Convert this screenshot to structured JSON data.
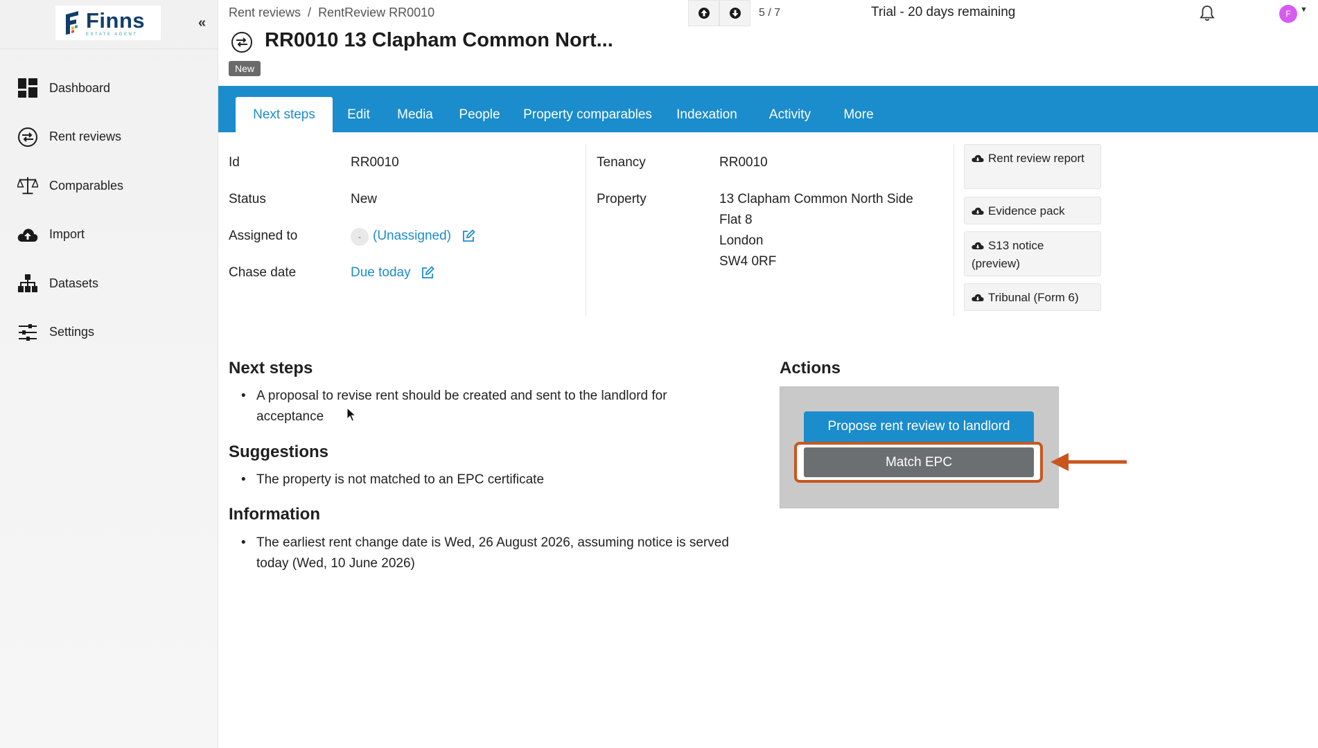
{
  "sidebar": {
    "logo_name": "Finns",
    "logo_sub": "ESTATE AGENT",
    "collapse_glyph": "«",
    "items": [
      {
        "label": "Dashboard",
        "icon": "dashboard-grid-icon"
      },
      {
        "label": "Rent reviews",
        "icon": "rent-review-icon"
      },
      {
        "label": "Comparables",
        "icon": "scales-icon"
      },
      {
        "label": "Import",
        "icon": "cloud-upload-icon"
      },
      {
        "label": "Datasets",
        "icon": "hierarchy-icon"
      },
      {
        "label": "Settings",
        "icon": "sliders-icon"
      }
    ]
  },
  "header": {
    "breadcrumb": {
      "root": "Rent reviews",
      "separator": "/",
      "current": "RentReview RR0010"
    },
    "pager": {
      "count": "5 / 7"
    },
    "trial": "Trial - 20 days remaining",
    "avatar_initial": "F",
    "title": "RR0010 13 Clapham Common Nort...",
    "status_badge": "New"
  },
  "tabs": [
    {
      "label": "Next steps",
      "active": true
    },
    {
      "label": "Edit"
    },
    {
      "label": "Media"
    },
    {
      "label": "People"
    },
    {
      "label": "Property comparables"
    },
    {
      "label": "Indexation"
    },
    {
      "label": "Activity"
    },
    {
      "label": "More"
    }
  ],
  "details": {
    "id_label": "Id",
    "id_value": "RR0010",
    "status_label": "Status",
    "status_value": "New",
    "assigned_label": "Assigned to",
    "assigned_chip": "-",
    "assigned_value": "(Unassigned)",
    "chase_label": "Chase date",
    "chase_value": "Due today",
    "tenancy_label": "Tenancy",
    "tenancy_value": "RR0010",
    "property_label": "Property",
    "property_lines": [
      "13 Clapham Common North Side",
      "Flat 8",
      "London",
      "SW4 0RF"
    ]
  },
  "documents": {
    "rent_review_report": "Rent review report",
    "evidence_pack": "Evidence pack",
    "s13_notice": "S13 notice (preview)",
    "tribunal": "Tribunal (Form 6)"
  },
  "next_steps": {
    "title": "Next steps",
    "items": [
      "A proposal to revise rent should be created and sent to the landlord for acceptance"
    ]
  },
  "suggestions": {
    "title": "Suggestions",
    "items": [
      "The property is not matched to an EPC certificate"
    ]
  },
  "information": {
    "title": "Information",
    "items": [
      "The earliest rent change date is Wed, 26 August 2026, assuming notice is served today (Wed, 10 June 2026)"
    ]
  },
  "actions": {
    "title": "Actions",
    "propose_label": "Propose rent review to landlord",
    "match_epc_label": "Match EPC"
  },
  "colors": {
    "brand_blue": "#1b8ccc",
    "highlight_orange": "#c8561e",
    "badge_grey": "#6a6a6a",
    "epc_button": "#6c6f72"
  }
}
